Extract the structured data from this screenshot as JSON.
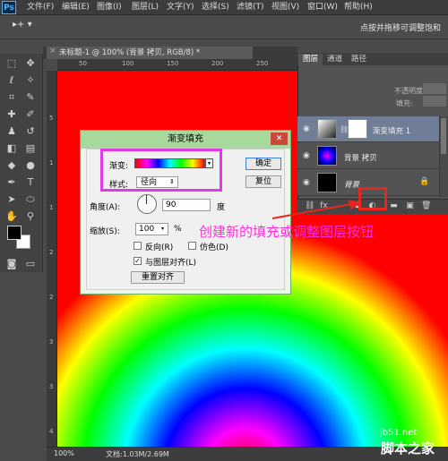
{
  "app": {
    "logo": "Ps"
  },
  "menu": [
    "文件(F)",
    "编辑(E)",
    "图像(I)",
    "图层(L)",
    "文字(Y)",
    "选择(S)",
    "滤镜(T)",
    "视图(V)",
    "窗口(W)",
    "帮助(H)"
  ],
  "options_bar": {
    "tool_glyph": "▸+ ▾",
    "right_text": "点按并拖移可调整饱和"
  },
  "document": {
    "tab_title": "未标题-1 @ 100% (背景 拷贝, RGB/8) *",
    "zoom": "100%",
    "doc_info": "文档:1.03M/2.69M",
    "ruler_top": [
      "50",
      "100",
      "150",
      "200",
      "250"
    ],
    "ruler_left": [
      "5",
      "1",
      "1",
      "2",
      "2",
      "3",
      "3",
      "4"
    ]
  },
  "panels": {
    "tabs": [
      "图层",
      "通道",
      "路径"
    ],
    "opacity_label": "填充:",
    "opacity_small": "不透明度:",
    "layers": [
      {
        "name": "渐变填充 1",
        "selected": true
      },
      {
        "name": "背景 拷贝",
        "selected": false
      },
      {
        "name": "背景",
        "selected": false
      }
    ],
    "footer_icons": [
      "link-icon",
      "fx-icon",
      "mask-icon",
      "adjustment-icon",
      "folder-icon",
      "new-layer-icon",
      "trash-icon"
    ]
  },
  "dialog": {
    "title": "渐变填充",
    "gradient_label": "渐变:",
    "style_label": "样式:",
    "style_value": "径向",
    "angle_label": "角度(A):",
    "angle_value": "90",
    "angle_unit": "度",
    "scale_label": "缩放(S):",
    "scale_value": "100",
    "scale_unit": "%",
    "reverse_label": "反向(R)",
    "dither_label": "仿色(D)",
    "align_label": "与图层对齐(L)",
    "align_checked": true,
    "reset_align_button": "重置对齐",
    "ok_button": "确定",
    "reset_button": "复位",
    "close_glyph": "✕"
  },
  "annotation": {
    "text": "创建新的填充或调整图层按钮",
    "color": "#ff2fd6",
    "highlight_color": "#e8261f"
  },
  "watermark": {
    "line1": "jb51.net",
    "line2": "脚本之家"
  }
}
